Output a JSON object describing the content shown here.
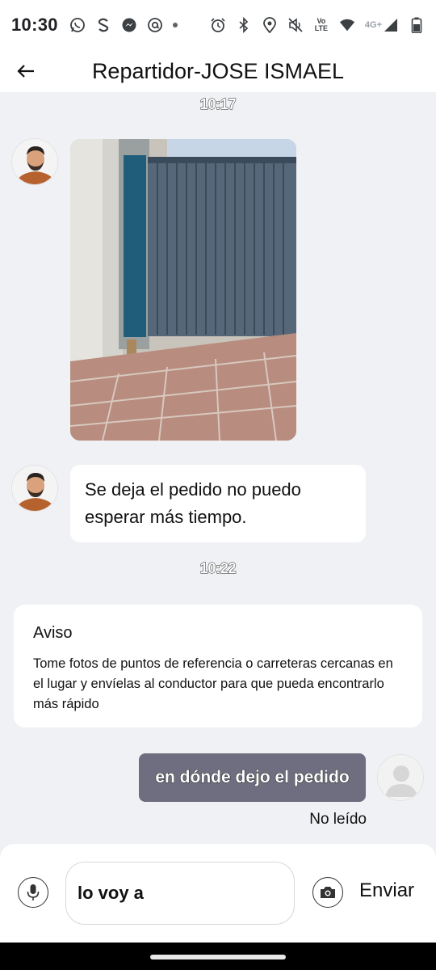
{
  "status_bar": {
    "time": "10:30",
    "left_icons": [
      "whatsapp-icon",
      "s-app-icon",
      "messenger-icon",
      "at-sign-icon",
      "dot-icon"
    ],
    "right_icons": [
      "alarm-icon",
      "bluetooth-icon",
      "location-icon",
      "mute-icon",
      "volte-icon",
      "wifi-icon",
      "signal-icon",
      "battery-icon"
    ],
    "volte_line1": "Vo",
    "volte_line2": "LTE",
    "network": "4G+"
  },
  "header": {
    "title": "Repartidor-JOSE ISMAEL"
  },
  "messages": {
    "timestamp_1": "10:17",
    "incoming_text": "Se deja el pedido no puedo esperar más tiempo.",
    "timestamp_2": "10:22",
    "notice_title": "Aviso",
    "notice_body": "Tome fotos de puntos de referencia o carreteras cercanas en el lugar y envíelas al conductor para que pueda encontrarlo más rápido",
    "outgoing_text": "en dónde dejo el pedido",
    "read_status": "No leído"
  },
  "composer": {
    "value": "lo voy a",
    "send_label": "Enviar"
  },
  "colors": {
    "outgoing_bubble": "#6e6e80",
    "chat_background": "#f0f1f5",
    "surface": "#ffffff"
  }
}
